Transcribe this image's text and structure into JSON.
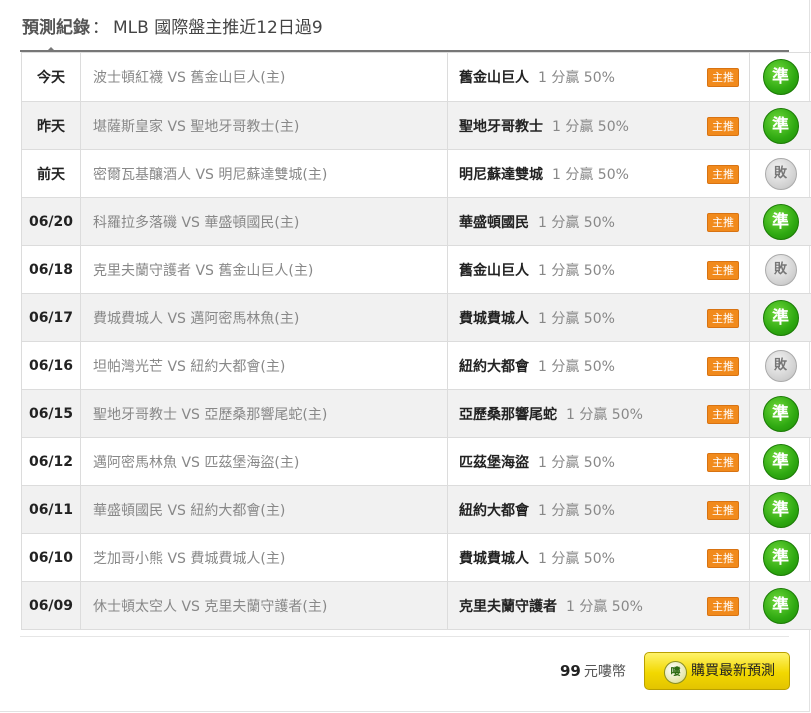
{
  "header": {
    "label": "預測紀錄",
    "separator": "：",
    "subtitle": "MLB 國際盤主推近12日過9"
  },
  "records": [
    {
      "date": "今天",
      "match": "波士頓紅襪 VS 舊金山巨人(主)",
      "pick": "舊金山巨人",
      "odds": "1 分贏 50%",
      "tag": "主推",
      "result": "準",
      "result_type": "win"
    },
    {
      "date": "昨天",
      "match": "堪薩斯皇家 VS 聖地牙哥教士(主)",
      "pick": "聖地牙哥教士",
      "odds": "1 分贏 50%",
      "tag": "主推",
      "result": "準",
      "result_type": "win"
    },
    {
      "date": "前天",
      "match": "密爾瓦基釀酒人 VS 明尼蘇達雙城(主)",
      "pick": "明尼蘇達雙城",
      "odds": "1 分贏 50%",
      "tag": "主推",
      "result": "敗",
      "result_type": "push"
    },
    {
      "date": "06/20",
      "match": "科羅拉多落磯 VS 華盛頓國民(主)",
      "pick": "華盛頓國民",
      "odds": "1 分贏 50%",
      "tag": "主推",
      "result": "準",
      "result_type": "win"
    },
    {
      "date": "06/18",
      "match": "克里夫蘭守護者 VS 舊金山巨人(主)",
      "pick": "舊金山巨人",
      "odds": "1 分贏 50%",
      "tag": "主推",
      "result": "敗",
      "result_type": "push"
    },
    {
      "date": "06/17",
      "match": "費城費城人 VS 邁阿密馬林魚(主)",
      "pick": "費城費城人",
      "odds": "1 分贏 50%",
      "tag": "主推",
      "result": "準",
      "result_type": "win"
    },
    {
      "date": "06/16",
      "match": "坦帕灣光芒 VS 紐約大都會(主)",
      "pick": "紐約大都會",
      "odds": "1 分贏 50%",
      "tag": "主推",
      "result": "敗",
      "result_type": "push"
    },
    {
      "date": "06/15",
      "match": "聖地牙哥教士 VS 亞歷桑那響尾蛇(主)",
      "pick": "亞歷桑那響尾蛇",
      "odds": "1 分贏 50%",
      "tag": "主推",
      "result": "準",
      "result_type": "win"
    },
    {
      "date": "06/12",
      "match": "邁阿密馬林魚 VS 匹茲堡海盜(主)",
      "pick": "匹茲堡海盜",
      "odds": "1 分贏 50%",
      "tag": "主推",
      "result": "準",
      "result_type": "win"
    },
    {
      "date": "06/11",
      "match": "華盛頓國民 VS 紐約大都會(主)",
      "pick": "紐約大都會",
      "odds": "1 分贏 50%",
      "tag": "主推",
      "result": "準",
      "result_type": "win"
    },
    {
      "date": "06/10",
      "match": "芝加哥小熊 VS 費城費城人(主)",
      "pick": "費城費城人",
      "odds": "1 分贏 50%",
      "tag": "主推",
      "result": "準",
      "result_type": "win"
    },
    {
      "date": "06/09",
      "match": "休士頓太空人 VS 克里夫蘭守護者(主)",
      "pick": "克里夫蘭守護者",
      "odds": "1 分贏 50%",
      "tag": "主推",
      "result": "準",
      "result_type": "win"
    }
  ],
  "footer": {
    "price_number": "99",
    "price_unit": "元嘍幣",
    "coin_icon_text": "嘍",
    "buy_label": "購買最新預測"
  },
  "colors": {
    "win_green": "#2ea811",
    "push_gray": "#cfcfcf",
    "tag_orange": "#f18a1c",
    "buy_yellow": "#f2d800"
  }
}
